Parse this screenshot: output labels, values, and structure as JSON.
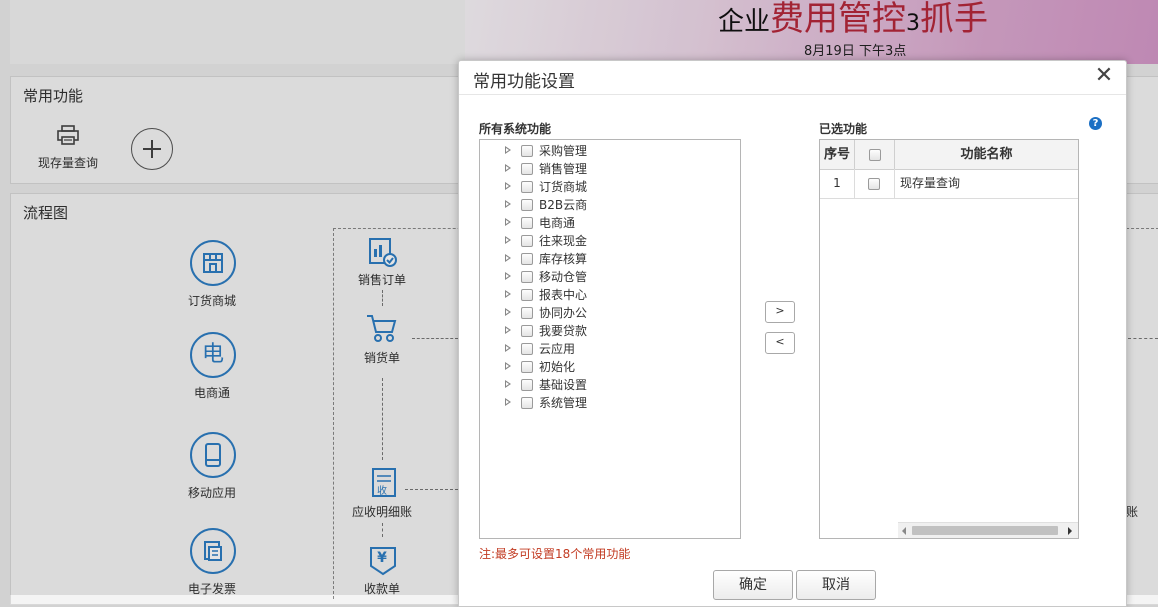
{
  "banner": {
    "title_prefix": "企业",
    "title_main": "费用管控",
    "title_num": "3",
    "title_tail": "抓手",
    "date": "8月19日  下午3点"
  },
  "common": {
    "title": "常用功能",
    "items": [
      {
        "label": "现存量查询",
        "icon": "printer-icon"
      }
    ]
  },
  "flow": {
    "title": "流程图",
    "left_items": [
      {
        "label": "订货商城",
        "icon": "storefront-icon"
      },
      {
        "label": "电商通",
        "icon_text": "电"
      },
      {
        "label": "移动应用",
        "icon": "mobile-icon"
      },
      {
        "label": "电子发票",
        "icon": "invoice-icon"
      }
    ],
    "nodes": [
      {
        "label": "销售订单",
        "icon": "sales-order-icon"
      },
      {
        "label": "销货单",
        "icon": "cart-icon"
      },
      {
        "label": "应收明细账",
        "icon_text": "收"
      },
      {
        "label": "收款单",
        "icon_text": "¥"
      }
    ],
    "right_partial": "账"
  },
  "dialog": {
    "title": "常用功能设置",
    "close_symbol": "✕",
    "all_label": "所有系统功能",
    "selected_label": "已选功能",
    "help_symbol": "?",
    "tree": [
      "采购管理",
      "销售管理",
      "订货商城",
      "B2B云商",
      "电商通",
      "往来现金",
      "库存核算",
      "移动仓管",
      "报表中心",
      "协同办公",
      "我要贷款",
      "云应用",
      "初始化",
      "基础设置",
      "系统管理"
    ],
    "move_right": ">",
    "move_left": "<",
    "grid": {
      "col_no": "序号",
      "col_name": "功能名称",
      "rows": [
        {
          "no": "1",
          "name": "现存量查询"
        }
      ]
    },
    "note": "注:最多可设置18个常用功能",
    "ok": "确定",
    "cancel": "取消"
  }
}
